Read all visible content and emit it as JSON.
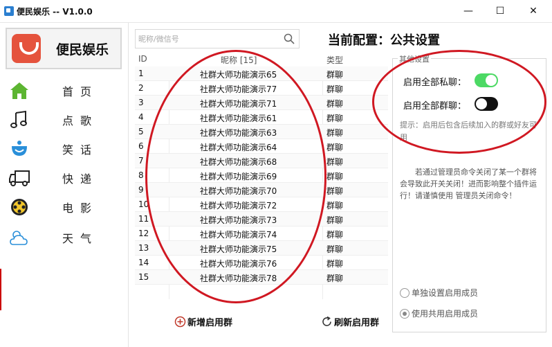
{
  "window": {
    "title": "便民娱乐 -- V1.0.0",
    "minimize_glyph": "—",
    "maximize_glyph": "☐",
    "close_glyph": "✕"
  },
  "sidebar": {
    "brand_name": "便民娱乐",
    "items": [
      {
        "label": "首页",
        "icon": "home-icon"
      },
      {
        "label": "点歌",
        "icon": "music-note-icon"
      },
      {
        "label": "笑话",
        "icon": "smile-icon"
      },
      {
        "label": "快递",
        "icon": "truck-icon"
      },
      {
        "label": "电影",
        "icon": "film-reel-icon"
      },
      {
        "label": "天气",
        "icon": "weather-icon"
      }
    ]
  },
  "search": {
    "placeholder": "昵称/微信号"
  },
  "config_title": "当前配置：公共设置",
  "table": {
    "headers": {
      "id": "ID",
      "name": "昵称 [15]",
      "type": "类型"
    },
    "rows": [
      {
        "id": "1",
        "name": "社群大师功能演示65",
        "type": "群聊"
      },
      {
        "id": "2",
        "name": "社群大师功能演示77",
        "type": "群聊"
      },
      {
        "id": "3",
        "name": "社群大师功能演示71",
        "type": "群聊"
      },
      {
        "id": "4",
        "name": "社群大师功能演示61",
        "type": "群聊"
      },
      {
        "id": "5",
        "name": "社群大师功能演示63",
        "type": "群聊"
      },
      {
        "id": "6",
        "name": "社群大师功能演示64",
        "type": "群聊"
      },
      {
        "id": "7",
        "name": "社群大师功能演示68",
        "type": "群聊"
      },
      {
        "id": "8",
        "name": "社群大师功能演示69",
        "type": "群聊"
      },
      {
        "id": "9",
        "name": "社群大师功能演示70",
        "type": "群聊"
      },
      {
        "id": "10",
        "name": "社群大师功能演示72",
        "type": "群聊"
      },
      {
        "id": "11",
        "name": "社群大师功能演示73",
        "type": "群聊"
      },
      {
        "id": "12",
        "name": "社群大师功能演示74",
        "type": "群聊"
      },
      {
        "id": "13",
        "name": "社群大师功能演示75",
        "type": "群聊"
      },
      {
        "id": "14",
        "name": "社群大师功能演示76",
        "type": "群聊"
      },
      {
        "id": "15",
        "name": "社群大师功能演示78",
        "type": "群聊"
      }
    ]
  },
  "actions": {
    "add_group": "新增启用群",
    "refresh_group": "刷新启用群"
  },
  "settings": {
    "legend": "其他设置",
    "private_chat_label": "启用全部私聊：",
    "private_chat_on": true,
    "group_chat_label": "启用全部群聊：",
    "group_chat_on": false,
    "hint": "提示：启用后包含后续加入的群或好友可用",
    "warning": "若通过管理员命令关闭了某一个群将会导致此开关关闭！进而影响整个插件运行！请谨慎使用 管理员关闭命令！",
    "radio_separate": "单独设置启用成员",
    "radio_shared": "使用共用启用成员",
    "radio_selected": "shared"
  },
  "colors": {
    "brand_red": "#e5533d",
    "toggle_on": "#4cd964",
    "toggle_off": "#111111",
    "annotation_red": "#d01822"
  }
}
